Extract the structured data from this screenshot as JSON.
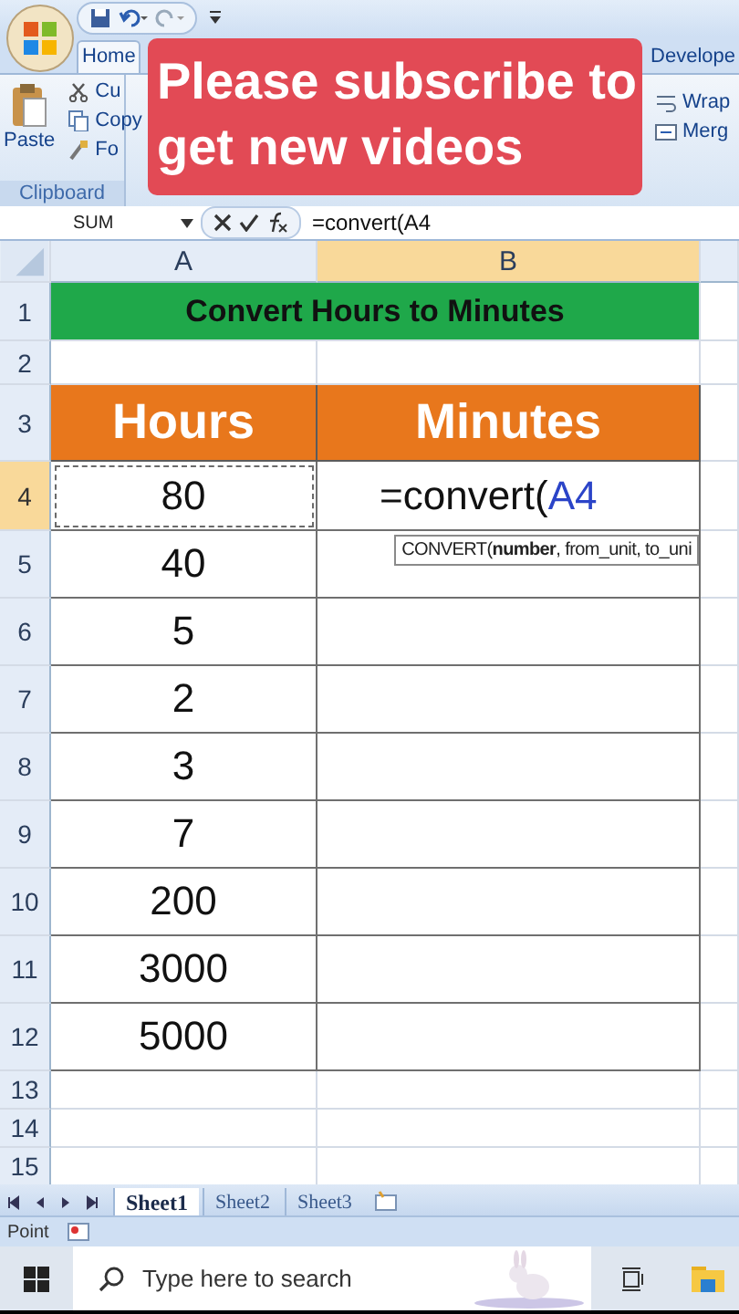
{
  "ribbon": {
    "tabs": [
      {
        "label": "Home",
        "selected": true
      },
      {
        "label": "Develope",
        "selected": false
      }
    ],
    "clipboard": {
      "paste": "Paste",
      "cut": "Cu",
      "copy": "Copy",
      "format_painter": "Fo",
      "group": "Clipboard"
    },
    "alignment": {
      "wrap": "Wrap",
      "merge": "Merg"
    }
  },
  "overlay_banner": {
    "text": "Please subscribe to get new videos"
  },
  "formula_bar": {
    "name_box": "SUM",
    "value": "=convert(A4"
  },
  "columns": [
    {
      "label": "A",
      "selected": false
    },
    {
      "label": "B",
      "selected": true
    }
  ],
  "rows": [
    {
      "number": "1",
      "selected": false,
      "kind": "title",
      "text": "Convert Hours to Minutes"
    },
    {
      "number": "2",
      "selected": false,
      "kind": "blank"
    },
    {
      "number": "3",
      "selected": false,
      "kind": "header",
      "cells": [
        "Hours",
        "Minutes"
      ]
    },
    {
      "number": "4",
      "selected": true,
      "kind": "editing",
      "cells": [
        "80"
      ],
      "marquee": true,
      "formula": {
        "text": "=convert(",
        "reference": "A4"
      },
      "tooltip": "CONVERT(**number**, from_unit, to_uni"
    },
    {
      "number": "5",
      "selected": false,
      "kind": "data",
      "cells": [
        "40"
      ]
    },
    {
      "number": "6",
      "selected": false,
      "kind": "data",
      "cells": [
        "5"
      ]
    },
    {
      "number": "7",
      "selected": false,
      "kind": "data",
      "cells": [
        "2"
      ]
    },
    {
      "number": "8",
      "selected": false,
      "kind": "data",
      "cells": [
        "3"
      ]
    },
    {
      "number": "9",
      "selected": false,
      "kind": "data",
      "cells": [
        "7"
      ]
    },
    {
      "number": "10",
      "selected": false,
      "kind": "data",
      "cells": [
        "200"
      ]
    },
    {
      "number": "11",
      "selected": false,
      "kind": "data",
      "cells": [
        "3000"
      ]
    },
    {
      "number": "12",
      "selected": false,
      "kind": "data",
      "cells": [
        "5000"
      ]
    },
    {
      "number": "13",
      "selected": false,
      "kind": "blank"
    },
    {
      "number": "14",
      "selected": false,
      "kind": "blank"
    },
    {
      "number": "15",
      "selected": false,
      "kind": "blank"
    }
  ],
  "sheet_tabs": [
    {
      "label": "Sheet1",
      "selected": true
    },
    {
      "label": "Sheet2",
      "selected": false
    },
    {
      "label": "Sheet3",
      "selected": false
    }
  ],
  "status_bar": {
    "mode": "Point"
  },
  "taskbar": {
    "search": {
      "placeholder": "Type here to search"
    }
  }
}
